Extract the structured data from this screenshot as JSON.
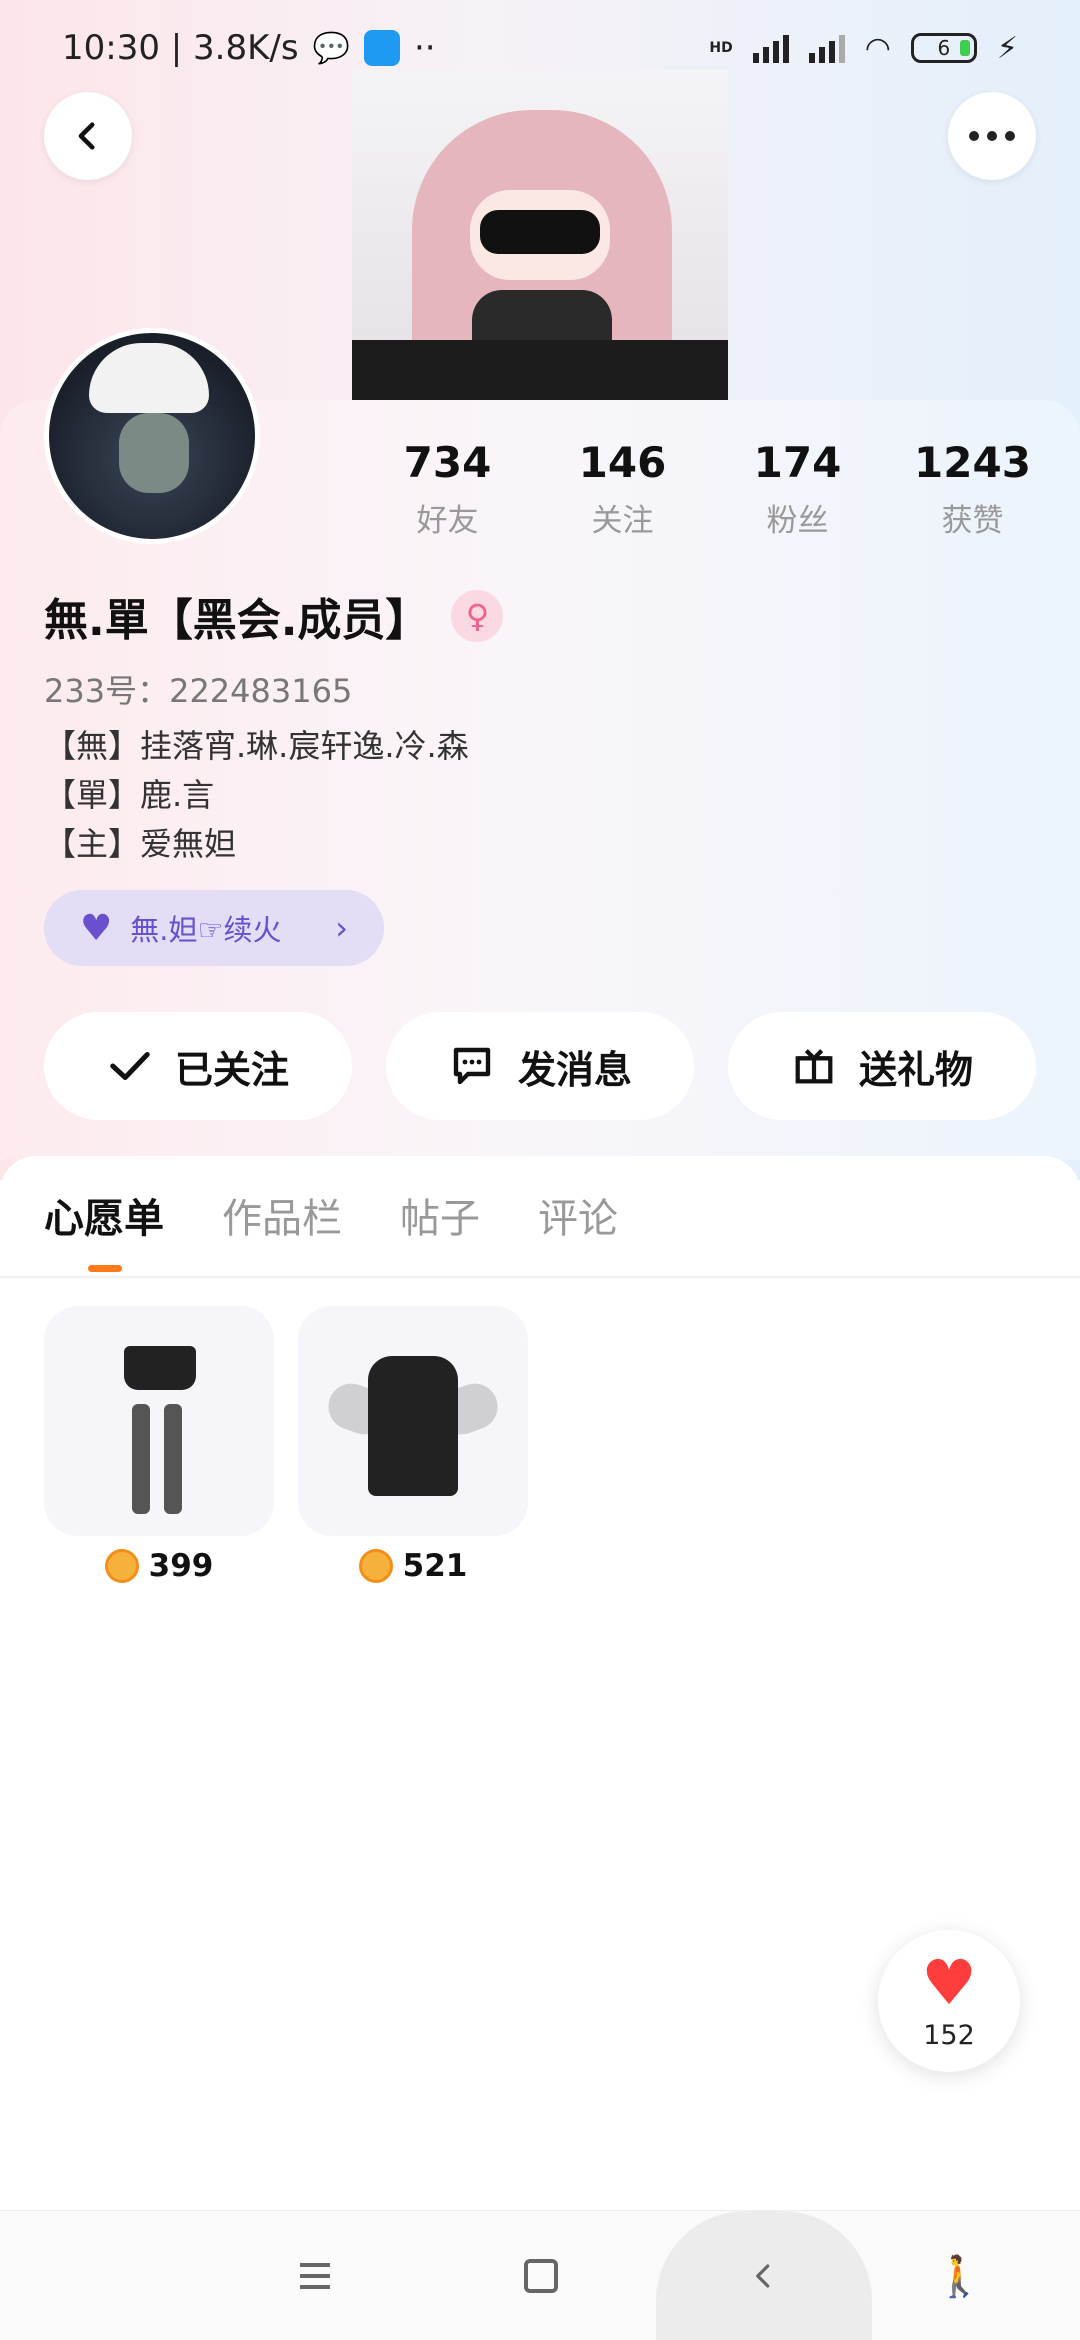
{
  "status_bar": {
    "time_speed": "10:30 | 3.8K/s",
    "extra": "··",
    "hd": "HD",
    "battery": "6"
  },
  "profile": {
    "name": "無.單【黑会.成员】",
    "gender_symbol": "♀",
    "uid": "233号：222483165",
    "bio_lines": [
      "【無】挂落宵.琳.宸轩逸.冷.森",
      "【單】鹿.言",
      "【主】爱無妲"
    ],
    "fire_pill": "無.妲☞续火"
  },
  "stats": [
    {
      "value": "734",
      "label": "好友"
    },
    {
      "value": "146",
      "label": "关注"
    },
    {
      "value": "174",
      "label": "粉丝"
    },
    {
      "value": "1243",
      "label": "获赞"
    }
  ],
  "actions": {
    "following": "已关注",
    "message": "发消息",
    "gift": "送礼物"
  },
  "tabs": [
    "心愿单",
    "作品栏",
    "帖子",
    "评论"
  ],
  "wishlist": [
    {
      "price": "399"
    },
    {
      "price": "521"
    }
  ],
  "like": {
    "count": "152"
  },
  "colors": {
    "accent_orange": "#ff7a1a",
    "pill_purple": "#6a4fcf",
    "heart_red": "#ff3d3d"
  }
}
